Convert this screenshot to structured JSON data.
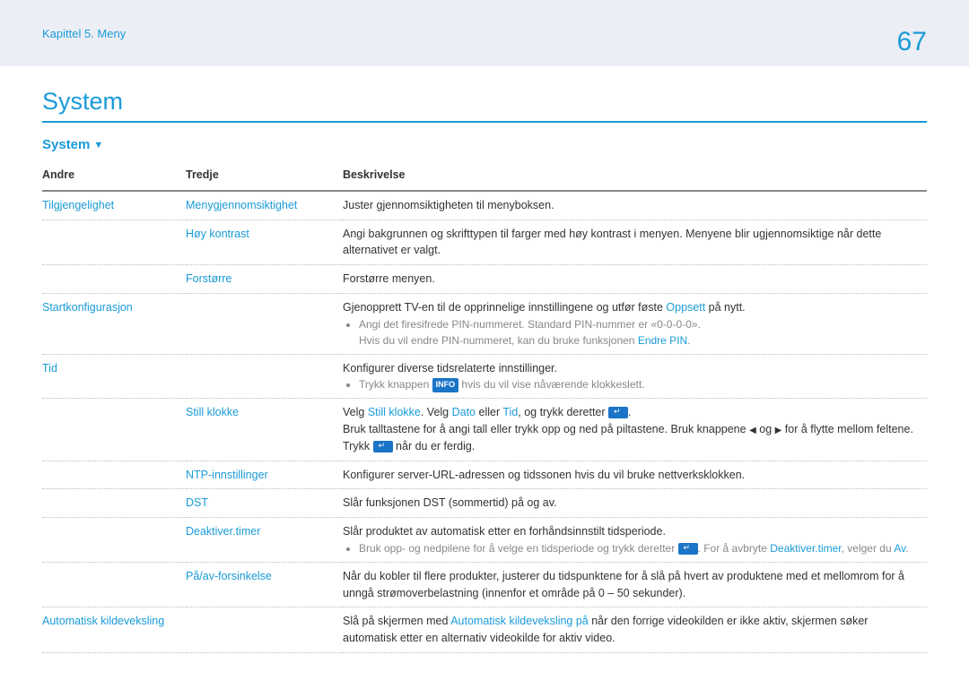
{
  "header": {
    "breadcrumb": "Kapittel 5. Meny",
    "page": "67"
  },
  "title": "System",
  "section": "System",
  "columns": {
    "andre": "Andre",
    "tredje": "Tredje",
    "beskrivelse": "Beskrivelse"
  },
  "rows": {
    "tilgj": {
      "andre": "Tilgjengelighet",
      "tredje": "Menygjennomsiktighet",
      "desc": "Juster gjennomsiktigheten til menyboksen."
    },
    "hoykontrast": {
      "tredje": "Høy kontrast",
      "desc": "Angi bakgrunnen og skrifttypen til farger med høy kontrast i menyen. Menyene blir ugjennomsiktige når dette alternativet er valgt."
    },
    "forstorre": {
      "tredje": "Forstørre",
      "desc": "Forstørre menyen."
    },
    "startkonfig": {
      "andre": "Startkonfigurasjon",
      "desc_pre": "Gjenopprett TV-en til de opprinnelige innstillingene og utfør føste ",
      "link": "Oppsett",
      "desc_post": " på nytt.",
      "bullet1": "Angi det firesifrede PIN-nummeret. Standard PIN-nummer er «0-0-0-0».",
      "bullet1b_pre": "Hvis du vil endre PIN-nummeret, kan du bruke funksjonen ",
      "bullet1b_link": "Endre PIN",
      "bullet1b_post": "."
    },
    "tid": {
      "andre": "Tid",
      "desc": "Konfigurer diverse tidsrelaterte innstillinger.",
      "bullet_pre": "Trykk knappen ",
      "bullet_info": "INFO",
      "bullet_post": " hvis du vil vise nåværende klokkeslett."
    },
    "stillklokke": {
      "tredje": "Still klokke",
      "l1_a": "Velg ",
      "l1_b": "Still klokke",
      "l1_c": ". Velg ",
      "l1_d": "Dato",
      "l1_e": " eller ",
      "l1_f": "Tid",
      "l1_g": ", og trykk deretter ",
      "l1_h": ".",
      "l2_a": "Bruk talltastene for å angi tall eller trykk opp og ned på piltastene. Bruk knappene ",
      "l2_b": " og ",
      "l2_c": " for å flytte mellom feltene. Trykk ",
      "l2_d": " når du er ferdig."
    },
    "ntp": {
      "tredje": "NTP-innstillinger",
      "desc": "Konfigurer server-URL-adressen og tidssonen hvis du vil bruke nettverksklokken."
    },
    "dst": {
      "tredje": "DST",
      "desc": "Slår funksjonen DST (sommertid) på og av."
    },
    "deaktiver": {
      "tredje": "Deaktiver.timer",
      "desc": "Slår produktet av automatisk etter en forhåndsinnstilt tidsperiode.",
      "b_pre": "Bruk opp- og nedpilene for å velge en tidsperiode og trykk deretter ",
      "b_mid": ". For å avbryte ",
      "b_link": "Deaktiver.timer",
      "b_mid2": ", velger du ",
      "b_link2": "Av",
      "b_post": "."
    },
    "paav": {
      "tredje": "På/av-forsinkelse",
      "desc": "Når du kobler til flere produkter, justerer du tidspunktene for å slå på hvert av produktene med et mellomrom for å unngå strømoverbelastning (innenfor et område på 0 – 50 sekunder)."
    },
    "autokilde": {
      "andre": "Automatisk kildeveksling",
      "d_pre": "Slå på skjermen med ",
      "d_link": "Automatisk kildeveksling på",
      "d_post": " når den forrige videokilden er ikke aktiv, skjermen søker automatisk etter en alternativ videokilde for aktiv video."
    }
  }
}
